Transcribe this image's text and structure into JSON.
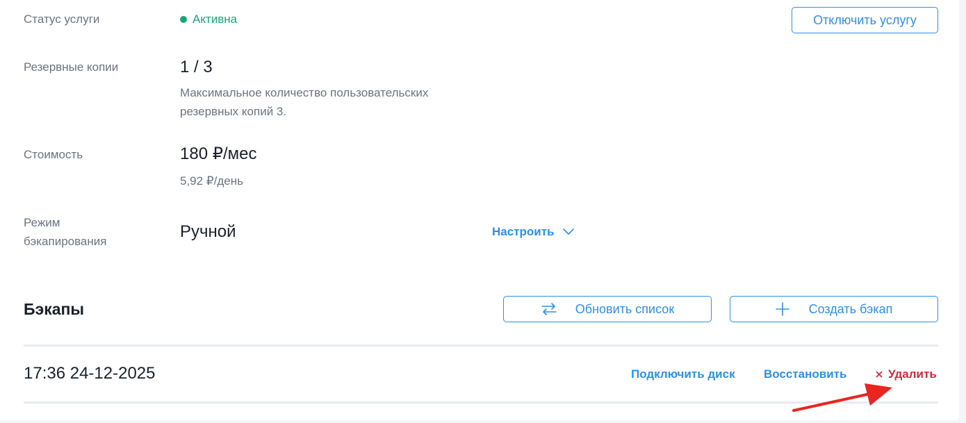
{
  "service": {
    "status_label": "Статус услуги",
    "status_value": "Активна",
    "status_color": "#17a673",
    "disable_button": "Отключить услугу"
  },
  "backups_info": {
    "label": "Резервные копии",
    "count": "1 / 3",
    "note_line1": "Максимальное количество пользовательских",
    "note_line2": "резервных копий 3."
  },
  "cost": {
    "label": "Стоимость",
    "monthly": "180 ₽/мес",
    "daily": "5,92 ₽/день"
  },
  "mode": {
    "label_line1": "Режим",
    "label_line2": "бэкапирования",
    "value": "Ручной",
    "configure_link": "Настроить",
    "configure_icon": "chevron-down-icon"
  },
  "backups_section": {
    "title": "Бэкапы",
    "refresh_button": "Обновить список",
    "refresh_icon": "swap-arrows-icon",
    "create_button": "Создать бэкап",
    "create_icon": "plus-icon"
  },
  "backup_rows": [
    {
      "timestamp": "17:36 24-12-2025",
      "attach_disk": "Подключить диск",
      "restore": "Восстановить",
      "delete_icon": "close-icon",
      "delete": "Удалить"
    }
  ],
  "colors": {
    "accent": "#2d8fe5",
    "danger": "#d22a3c",
    "annotation_arrow": "#e8261f"
  }
}
